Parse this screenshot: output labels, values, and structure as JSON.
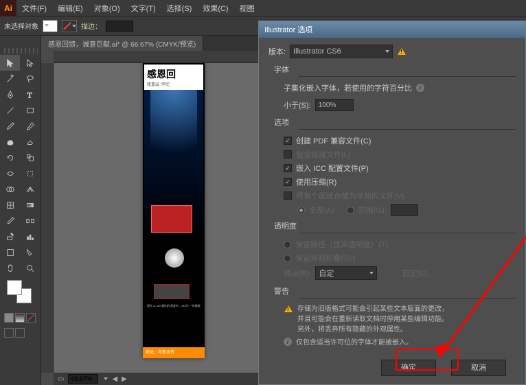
{
  "menubar": {
    "items": [
      "文件(F)",
      "编辑(E)",
      "对象(O)",
      "文字(T)",
      "选择(S)",
      "效果(C)",
      "视图"
    ]
  },
  "options_bar": {
    "no_selection": "未选择对象",
    "label_desc": "描边："
  },
  "doc_tab": "感恩回馈，诚意巨献.ai* @ 66.67% (CMYK/预览)",
  "poster": {
    "title": "感恩回",
    "subtitle": "隆重出 \"阿忆",
    "spec": "双光 A-780 游忆机\n首发价：240元\n一年保修",
    "bottom": "地址：乌鲁木齐"
  },
  "status": {
    "zoom": "66.67%"
  },
  "dialog": {
    "title": "Illustrator 选项",
    "version_label": "版本:",
    "version_value": "Illustrator CS6",
    "font_section": "字体",
    "font_desc": "子集化嵌入字体，若使用的字符百分比",
    "font_lt": "小于(S):",
    "font_pct": "100%",
    "options_section": "选项",
    "opt_pdf": "创建 PDF 兼容文件(C)",
    "opt_link": "包含链接文件(L)",
    "opt_icc": "嵌入 ICC 配置文件(P)",
    "opt_comp": "使用压缩(R)",
    "opt_artboard": "将每个画板存储为单独的文件(V)",
    "opt_all": "全部(A)",
    "opt_range": "范围(G):",
    "trans_section": "透明度",
    "trans_path": "保留路径（放弃透明度）(T)",
    "trans_overprint": "保留外观和叠印(I)",
    "trans_preset": "预设(R):",
    "trans_preset_val": "自定",
    "trans_custom_btn": "自定(U)...",
    "warn_section": "警告",
    "warn1": "存储为旧版格式可能会引起某些文本版面的更改，\n并且可能会在重新读取文档时停用某些编辑功能。\n另外，将丢弃所有隐藏的外观属性。",
    "warn2": "仅包含适当许可位的字体才能被嵌入。",
    "ok": "确定",
    "cancel": "取消"
  }
}
